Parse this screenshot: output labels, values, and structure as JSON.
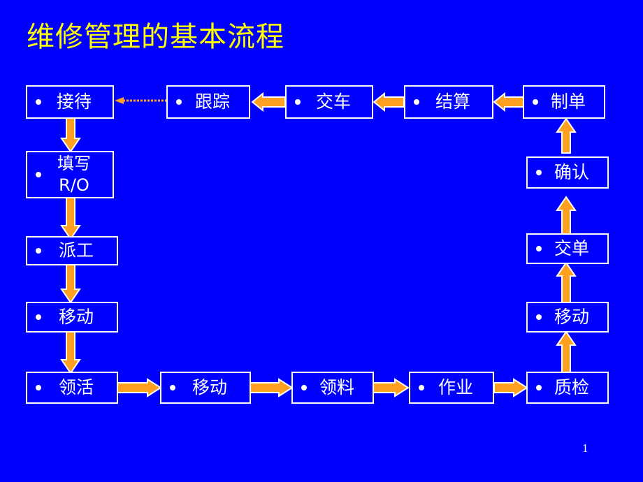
{
  "slide": {
    "title": "维修管理的基本流程",
    "page_number": "1",
    "background_color": "#0000FF",
    "title_color": "#FFFF00",
    "box_border_color": "#FFFFFF",
    "box_text_color": "#FFFFFF",
    "arrow_color": "#FFA020"
  },
  "chart_data": {
    "type": "diagram",
    "title": "维修管理的基本流程",
    "nodes": [
      {
        "id": "n1",
        "label": "接待",
        "row": "top",
        "col": 1
      },
      {
        "id": "n2",
        "label": "跟踪",
        "row": "top",
        "col": 2
      },
      {
        "id": "n3",
        "label": "交车",
        "row": "top",
        "col": 3
      },
      {
        "id": "n4",
        "label": "结算",
        "row": "top",
        "col": 4
      },
      {
        "id": "n5",
        "label": "制单",
        "row": "top",
        "col": 5
      },
      {
        "id": "n6",
        "label": "填写\nR/O",
        "row": "left",
        "col": 1
      },
      {
        "id": "n7",
        "label": "派工",
        "row": "left",
        "col": 1
      },
      {
        "id": "n8",
        "label": "移动",
        "row": "left",
        "col": 1
      },
      {
        "id": "n9",
        "label": "领活",
        "row": "bottom",
        "col": 1
      },
      {
        "id": "n10",
        "label": "移动",
        "row": "bottom",
        "col": 2
      },
      {
        "id": "n11",
        "label": "领料",
        "row": "bottom",
        "col": 3
      },
      {
        "id": "n12",
        "label": "作业",
        "row": "bottom",
        "col": 4
      },
      {
        "id": "n13",
        "label": "质检",
        "row": "bottom",
        "col": 5
      },
      {
        "id": "n14",
        "label": "移动",
        "row": "right",
        "col": 5
      },
      {
        "id": "n15",
        "label": "交单",
        "row": "right",
        "col": 5
      },
      {
        "id": "n16",
        "label": "确认",
        "row": "right",
        "col": 5
      }
    ],
    "edges": [
      {
        "from": "n2",
        "to": "n1",
        "style": "dashed-thin",
        "direction": "left"
      },
      {
        "from": "n3",
        "to": "n2",
        "style": "block",
        "direction": "left"
      },
      {
        "from": "n4",
        "to": "n3",
        "style": "block",
        "direction": "left"
      },
      {
        "from": "n5",
        "to": "n4",
        "style": "block",
        "direction": "left"
      },
      {
        "from": "n1",
        "to": "n6",
        "style": "block",
        "direction": "down"
      },
      {
        "from": "n6",
        "to": "n7",
        "style": "block",
        "direction": "down"
      },
      {
        "from": "n7",
        "to": "n8",
        "style": "block",
        "direction": "down"
      },
      {
        "from": "n8",
        "to": "n9",
        "style": "block",
        "direction": "down"
      },
      {
        "from": "n9",
        "to": "n10",
        "style": "block",
        "direction": "right"
      },
      {
        "from": "n10",
        "to": "n11",
        "style": "block",
        "direction": "right"
      },
      {
        "from": "n11",
        "to": "n12",
        "style": "block",
        "direction": "right"
      },
      {
        "from": "n12",
        "to": "n13",
        "style": "block",
        "direction": "right"
      },
      {
        "from": "n13",
        "to": "n14",
        "style": "block",
        "direction": "up"
      },
      {
        "from": "n14",
        "to": "n15",
        "style": "block",
        "direction": "up"
      },
      {
        "from": "n15",
        "to": "n16",
        "style": "block",
        "direction": "up"
      },
      {
        "from": "n16",
        "to": "n5",
        "style": "block",
        "direction": "up"
      }
    ]
  }
}
